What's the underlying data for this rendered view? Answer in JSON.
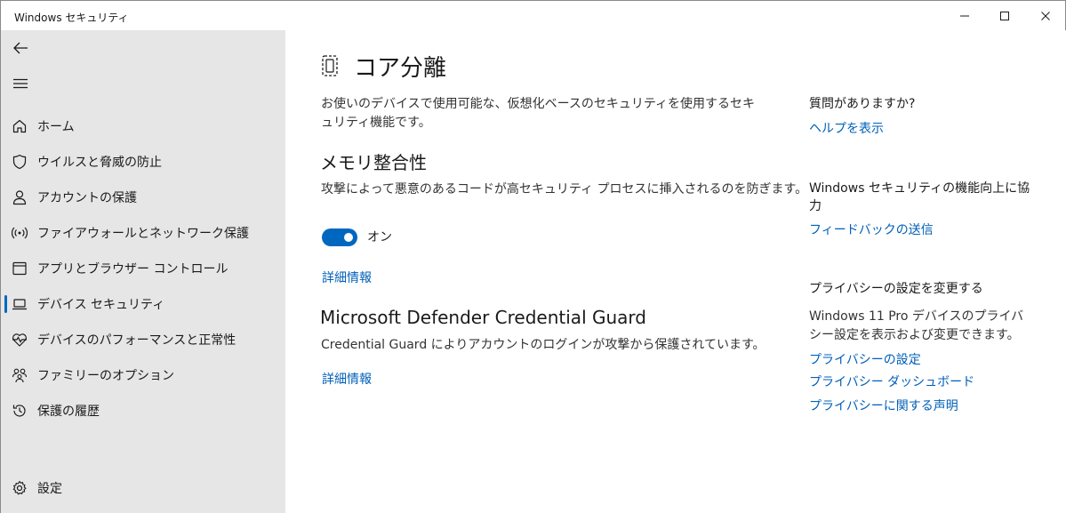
{
  "window": {
    "title": "Windows セキュリティ"
  },
  "sidebar": {
    "items": [
      {
        "label": "ホーム",
        "icon": "home-icon"
      },
      {
        "label": "ウイルスと脅威の防止",
        "icon": "shield-icon"
      },
      {
        "label": "アカウントの保護",
        "icon": "person-icon"
      },
      {
        "label": "ファイアウォールとネットワーク保護",
        "icon": "wifi-antenna-icon"
      },
      {
        "label": "アプリとブラウザー コントロール",
        "icon": "app-browser-icon"
      },
      {
        "label": "デバイス セキュリティ",
        "icon": "laptop-icon",
        "active": true
      },
      {
        "label": "デバイスのパフォーマンスと正常性",
        "icon": "heart-pulse-icon"
      },
      {
        "label": "ファミリーのオプション",
        "icon": "family-icon"
      },
      {
        "label": "保護の履歴",
        "icon": "history-icon"
      }
    ],
    "settings_label": "設定"
  },
  "main": {
    "title": "コア分離",
    "description": "お使いのデバイスで使用可能な、仮想化ベースのセキュリティを使用するセキュリティ機能です。",
    "memory_integrity": {
      "title": "メモリ整合性",
      "description": "攻撃によって悪意のあるコードが高セキュリティ プロセスに挿入されるのを防ぎます。",
      "toggle_label": "オン",
      "toggle_on": true,
      "more_info": "詳細情報"
    },
    "credential_guard": {
      "title": "Microsoft Defender Credential Guard",
      "description": "Credential Guard によりアカウントのログインが攻撃から保護されています。",
      "more_info": "詳細情報"
    }
  },
  "right_panel": {
    "help_title": "質問がありますか?",
    "help_link": "ヘルプを表示",
    "improve_title": "Windows セキュリティの機能向上に協力",
    "feedback_link": "フィードバックの送信",
    "privacy_title": "プライバシーの設定を変更する",
    "privacy_text": "Windows 11 Pro デバイスのプライバシー設定を表示および変更できます。",
    "privacy_links": [
      "プライバシーの設定",
      "プライバシー ダッシュボード",
      "プライバシーに関する声明"
    ]
  },
  "colors": {
    "accent": "#0067c0",
    "link": "#005fb8",
    "sidebar_bg": "#e6e6e6"
  }
}
